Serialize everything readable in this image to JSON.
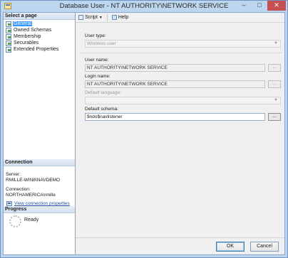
{
  "window": {
    "title": "Database User - NT AUTHORITY\\NETWORK SERVICE",
    "minimize": "–",
    "maximize": "□",
    "close": "✕"
  },
  "left_panel": {
    "select_page_header": "Select a page",
    "pages": [
      {
        "label": "General",
        "selected": true
      },
      {
        "label": "Owned Schemas",
        "selected": false
      },
      {
        "label": "Membership",
        "selected": false
      },
      {
        "label": "Securables",
        "selected": false
      },
      {
        "label": "Extended Properties",
        "selected": false
      }
    ],
    "connection_header": "Connection",
    "server_label": "Server:",
    "server_value": "RMILLE-WIN8\\NAVDEMO",
    "connection_label": "Connection:",
    "connection_value": "NORTHAMERICA\\rmille",
    "view_connection_link": "View connection properties",
    "progress_header": "Progress",
    "progress_status": "Ready"
  },
  "toolbar": {
    "script_label": "Script",
    "help_label": "Help"
  },
  "form": {
    "user_type_label": "User type:",
    "user_type_value": "Windows user",
    "user_name_label": "User name:",
    "user_name_value": "NT AUTHORITY\\NETWORK SERVICE",
    "login_name_label": "Login name:",
    "login_name_value": "NT AUTHORITY\\NETWORK SERVICE",
    "default_language_label": "Default language:",
    "default_language_value": "",
    "default_schema_label": "Default schema:",
    "default_schema_value": "$ndo$navlistener",
    "browse_label": "..."
  },
  "buttons": {
    "ok": "OK",
    "cancel": "Cancel"
  }
}
